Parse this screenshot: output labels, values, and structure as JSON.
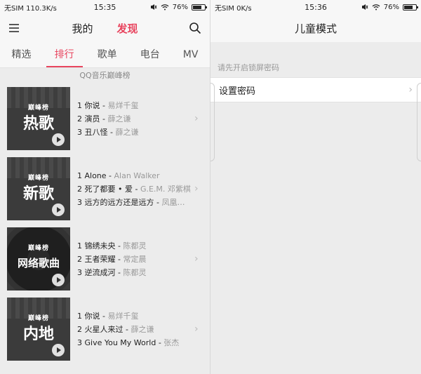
{
  "left": {
    "status": {
      "carrier": "无SIM 110.3K/s",
      "time": "15:35",
      "battery": "76%",
      "battery_level": 0.76
    },
    "top_tabs": [
      {
        "label": "我的"
      },
      {
        "label": "发现"
      }
    ],
    "sub_tabs": [
      {
        "label": "精选"
      },
      {
        "label": "排行"
      },
      {
        "label": "歌单"
      },
      {
        "label": "电台"
      },
      {
        "label": "MV"
      }
    ],
    "section_title": "QQ音乐巅峰榜",
    "charts": [
      {
        "brand": "巅峰榜",
        "cover_title": "热歌",
        "songs": [
          {
            "title": "1 你说",
            "artist": "易烊千玺"
          },
          {
            "title": "2 演员",
            "artist": "薛之谦"
          },
          {
            "title": "3 丑八怪",
            "artist": "薛之谦"
          }
        ]
      },
      {
        "brand": "巅峰榜",
        "cover_title": "新歌",
        "songs": [
          {
            "title": "1 Alone",
            "artist": "Alan Walker"
          },
          {
            "title": "2 死了都要 • 爱",
            "artist": "G.E.M. 邓紫棋"
          },
          {
            "title": "3 远方的远方还是远方",
            "artist": "凤凰…"
          }
        ]
      },
      {
        "brand": "巅峰榜",
        "cover_title": "网络歌曲",
        "songs": [
          {
            "title": "1 锦绣未央",
            "artist": "陈都灵"
          },
          {
            "title": "2 王者荣耀",
            "artist": "常定晨"
          },
          {
            "title": "3 逆流成河",
            "artist": "陈都灵"
          }
        ]
      },
      {
        "brand": "巅峰榜",
        "cover_title": "内地",
        "songs": [
          {
            "title": "1 你说",
            "artist": "易烊千玺"
          },
          {
            "title": "2 火星人来过",
            "artist": "薛之谦"
          },
          {
            "title": "3 Give You My World",
            "artist": "张杰"
          }
        ]
      }
    ]
  },
  "right": {
    "status": {
      "carrier": "无SIM 0K/s",
      "time": "15:36",
      "battery": "76%",
      "battery_level": 0.76
    },
    "title": "儿童模式",
    "hint": "请先开启锁屏密码",
    "row_label": "设置密码"
  },
  "colors": {
    "accent": "#e8445e"
  }
}
